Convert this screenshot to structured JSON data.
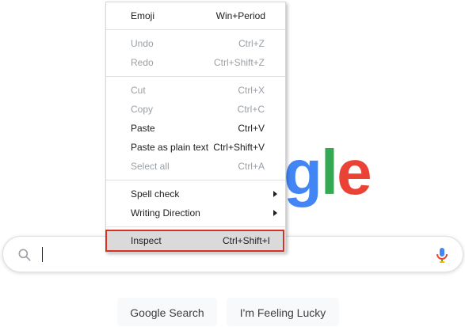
{
  "logo": {
    "letters_visible": [
      "g",
      "l",
      "e"
    ]
  },
  "search": {
    "placeholder": "",
    "value": "",
    "icon": "search-icon",
    "mic_icon": "mic-icon"
  },
  "buttons": {
    "google_search": "Google Search",
    "feeling_lucky": "I'm Feeling Lucky"
  },
  "context_menu": {
    "items": [
      {
        "label": "Emoji",
        "shortcut": "Win+Period",
        "enabled": true
      },
      {
        "label": "Undo",
        "shortcut": "Ctrl+Z",
        "enabled": false
      },
      {
        "label": "Redo",
        "shortcut": "Ctrl+Shift+Z",
        "enabled": false
      },
      {
        "label": "Cut",
        "shortcut": "Ctrl+X",
        "enabled": false
      },
      {
        "label": "Copy",
        "shortcut": "Ctrl+C",
        "enabled": false
      },
      {
        "label": "Paste",
        "shortcut": "Ctrl+V",
        "enabled": true
      },
      {
        "label": "Paste as plain text",
        "shortcut": "Ctrl+Shift+V",
        "enabled": true
      },
      {
        "label": "Select all",
        "shortcut": "Ctrl+A",
        "enabled": false
      },
      {
        "label": "Spell check",
        "submenu": true,
        "enabled": true
      },
      {
        "label": "Writing Direction",
        "submenu": true,
        "enabled": true
      },
      {
        "label": "Inspect",
        "shortcut": "Ctrl+Shift+I",
        "enabled": true,
        "highlighted": true
      }
    ]
  },
  "colors": {
    "google_blue": "#4285F4",
    "google_green": "#34A853",
    "google_red": "#EA4335",
    "highlight_outline": "#d93025"
  }
}
